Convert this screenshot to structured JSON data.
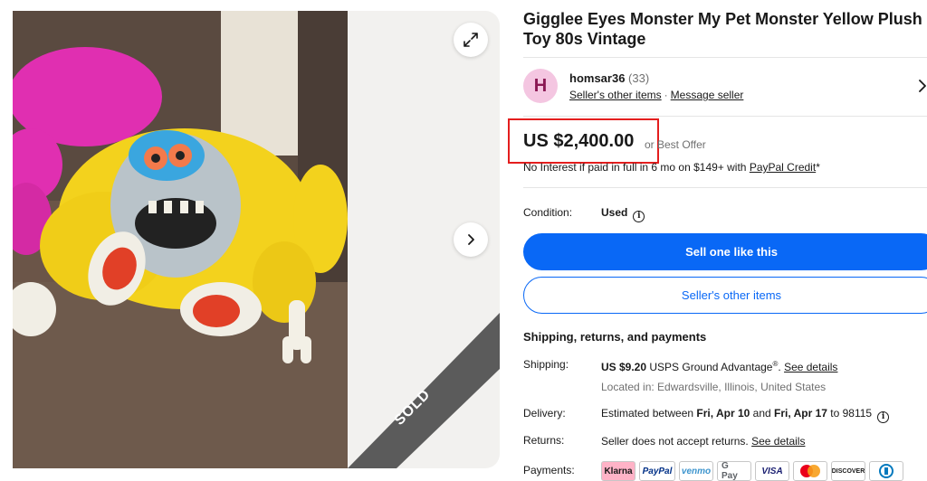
{
  "listing": {
    "title": "Gigglee Eyes Monster My Pet Monster Yellow Plush Toy 80s Vintage",
    "sold_label": "SOLD"
  },
  "gallery": {
    "expand_icon": "expand-icon",
    "next_icon": "chevron-right-icon"
  },
  "seller": {
    "avatar_letter": "H",
    "name": "homsar36",
    "feedback_count": "(33)",
    "other_items_link": "Seller's other items",
    "separator": "·",
    "message_link": "Message seller"
  },
  "price": {
    "amount": "US $2,400.00",
    "best_offer": "or Best Offer",
    "finance_text": "No Interest if paid in full in 6 mo on $149+ with ",
    "finance_link": "PayPal Credit",
    "finance_suffix": "*"
  },
  "condition": {
    "label": "Condition:",
    "value": "Used"
  },
  "actions": {
    "primary": "Sell one like this",
    "secondary": "Seller's other items"
  },
  "shipping": {
    "section_title": "Shipping, returns, and payments",
    "shipping_label": "Shipping:",
    "shipping_price": "US $9.20",
    "shipping_service": " USPS Ground Advantage",
    "shipping_reg": "®",
    "shipping_period": ". ",
    "shipping_link": "See details",
    "location": "Located in: Edwardsville, Illinois, United States",
    "delivery_label": "Delivery:",
    "delivery_prefix": "Estimated between ",
    "delivery_start": "Fri, Apr 10",
    "delivery_and": " and ",
    "delivery_end": "Fri, Apr 17",
    "delivery_suffix": " to 98115",
    "returns_label": "Returns:",
    "returns_text": "Seller does not accept returns. ",
    "returns_link": "See details",
    "payments_label": "Payments:"
  },
  "payment_methods": [
    "Klarna",
    "PayPal",
    "venmo",
    "G Pay",
    "VISA",
    "",
    "DISCOVER",
    ""
  ],
  "colors": {
    "accent_blue": "#0968f6",
    "highlight_red": "#e41e1e",
    "sold_ribbon": "#5b5b5b",
    "avatar_bg": "#f4c6e1"
  }
}
